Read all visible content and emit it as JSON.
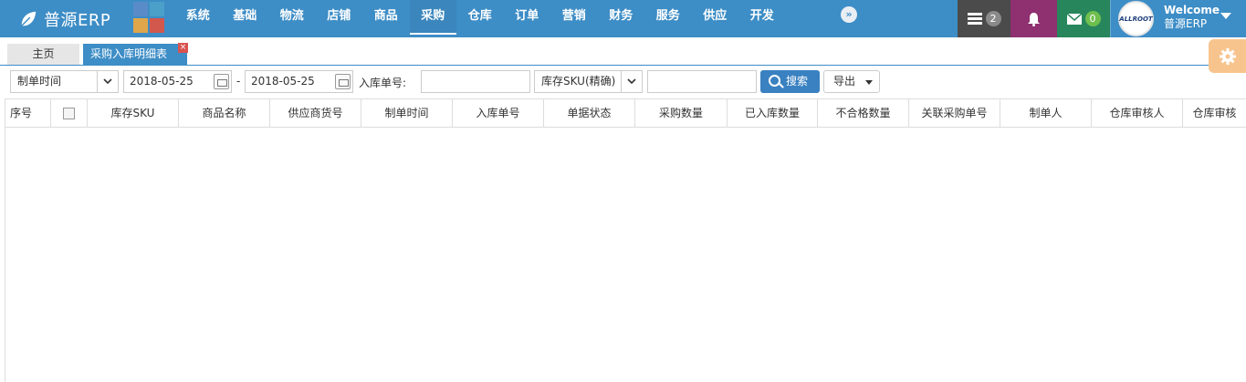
{
  "app": {
    "brand": "普源ERP",
    "more_icon": "double-chevron-right-icon"
  },
  "logo_tile_colors": [
    "#5a8bc9",
    "#4aa0c9",
    "#e0a64b",
    "#d2574d"
  ],
  "nav": {
    "items": [
      {
        "label": "系统"
      },
      {
        "label": "基础"
      },
      {
        "label": "物流"
      },
      {
        "label": "店铺"
      },
      {
        "label": "商品"
      },
      {
        "label": "采购",
        "active": true
      },
      {
        "label": "仓库"
      },
      {
        "label": "订单"
      },
      {
        "label": "营销"
      },
      {
        "label": "财务"
      },
      {
        "label": "服务"
      },
      {
        "label": "供应"
      },
      {
        "label": "开发"
      }
    ]
  },
  "header_right": {
    "tasks_count": "2",
    "mail_count": "0",
    "avatar_text": "ALLROOT",
    "welcome": "Welcome",
    "username": "普源ERP"
  },
  "tabs": {
    "home": "主页",
    "current": "采购入库明细表",
    "close": "×"
  },
  "filters": {
    "date_type": "制单时间",
    "date_from": "2018-05-25",
    "date_sep": "-",
    "date_to": "2018-05-25",
    "inbound_no_label": "入库单号:",
    "sku_mode": "库存SKU(精确)",
    "search_label": "搜索",
    "export_label": "导出"
  },
  "table": {
    "columns": [
      "序号",
      "",
      "库存SKU",
      "商品名称",
      "供应商货号",
      "制单时间",
      "入库单号",
      "单据状态",
      "采购数量",
      "已入库数量",
      "不合格数量",
      "关联采购单号",
      "制单人",
      "仓库审核人",
      "仓库审核"
    ],
    "rows": []
  },
  "colors": {
    "primary": "#3d8dc6",
    "bell_bg": "#8f3070",
    "mail_bg": "#27865b",
    "tasks_bg": "#4b4b4b",
    "gear_bg": "#f8c48e"
  }
}
